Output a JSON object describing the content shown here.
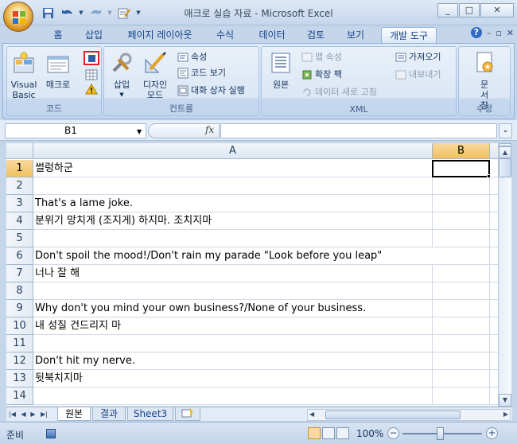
{
  "window": {
    "title": "매크로 실습 자료 - Microsoft Excel",
    "controls": [
      "_",
      "□",
      "X"
    ]
  },
  "qat": {
    "save_icon": "save-icon",
    "undo_icon": "undo-icon",
    "redo_icon": "redo-icon",
    "customize_icon": "customize-icon"
  },
  "ribbon": {
    "tabs": [
      "홈",
      "삽입",
      "페이지 레이아웃",
      "수식",
      "데이터",
      "검토",
      "보기",
      "개발 도구"
    ],
    "active_tab": "개발 도구",
    "groups": {
      "code": {
        "label": "코드",
        "visual_basic": "Visual Basic",
        "macro": "매크로"
      },
      "controls": {
        "label": "컨트롤",
        "insert": "삽입",
        "design_mode": "디자인 모드",
        "properties": "속성",
        "view_code": "코드 보기",
        "run_dialog": "대화 상자 실행"
      },
      "xml": {
        "label": "XML",
        "source": "원본",
        "map_properties": "맵 속성",
        "expansion_packs": "확장 팩",
        "refresh_data": "데이터 새로 고침",
        "import": "가져오기",
        "export": "내보내기"
      },
      "modify": {
        "label": "수정",
        "document_panel": "문서 창"
      }
    }
  },
  "formula_bar": {
    "name_box": "B1",
    "fx": "fx",
    "formula": ""
  },
  "sheet": {
    "columns": [
      "A",
      "B"
    ],
    "selected_cell": "B1",
    "rows": [
      {
        "num": "1",
        "a": "썰렁하군"
      },
      {
        "num": "2",
        "a": ""
      },
      {
        "num": "3",
        "a": "That's a lame joke."
      },
      {
        "num": "4",
        "a": "분위기 망치게 (조지게) 하지마. 조치지마"
      },
      {
        "num": "5",
        "a": ""
      },
      {
        "num": "6",
        "a": "Don't spoil the mood!/Don't rain my parade \"Look before you leap\""
      },
      {
        "num": "7",
        "a": "너나 잘 해"
      },
      {
        "num": "8",
        "a": ""
      },
      {
        "num": "9",
        "a": "Why don't you mind your own business?/None of your business."
      },
      {
        "num": "10",
        "a": "내 성질 건드리지 마"
      },
      {
        "num": "11",
        "a": ""
      },
      {
        "num": "12",
        "a": "Don't hit my nerve."
      },
      {
        "num": "13",
        "a": "뒷북치지마"
      },
      {
        "num": "14",
        "a": ""
      }
    ]
  },
  "sheet_tabs": [
    "원본",
    "결과",
    "Sheet3"
  ],
  "active_sheet": "원본",
  "status": {
    "ready": "준비",
    "zoom": "100%",
    "zoom_level_percent": 100
  },
  "colors": {
    "accent": "#15428b",
    "highlight_header": "#f1c15f",
    "macro_button_border": "#e02020"
  }
}
